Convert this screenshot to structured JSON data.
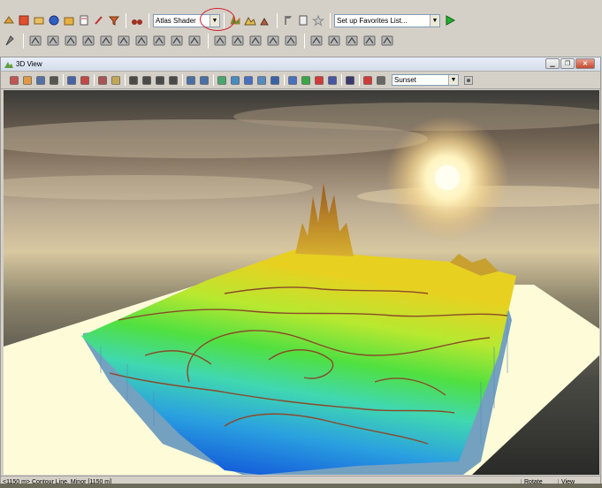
{
  "toolbar": {
    "shader_select": "Atlas Shader",
    "favorites_select": "Set up Favorites List...",
    "icons_row1": [
      "open-icon",
      "color-icon",
      "layer-icon",
      "globe-icon",
      "folder-icon",
      "doc-icon",
      "pen-icon",
      "funnel-icon",
      "binoculars-icon"
    ],
    "icons_row2_count": 20
  },
  "view3d": {
    "title": "3D View",
    "sky_select": "Sunset"
  },
  "statusbar": {
    "info": "<1150 m> Contour Line, Minor [1150 m]",
    "mode": "Rotate",
    "view": "View"
  },
  "colors": {
    "highlight_circle": "#d2202a",
    "plane": "#fdfbd8"
  }
}
